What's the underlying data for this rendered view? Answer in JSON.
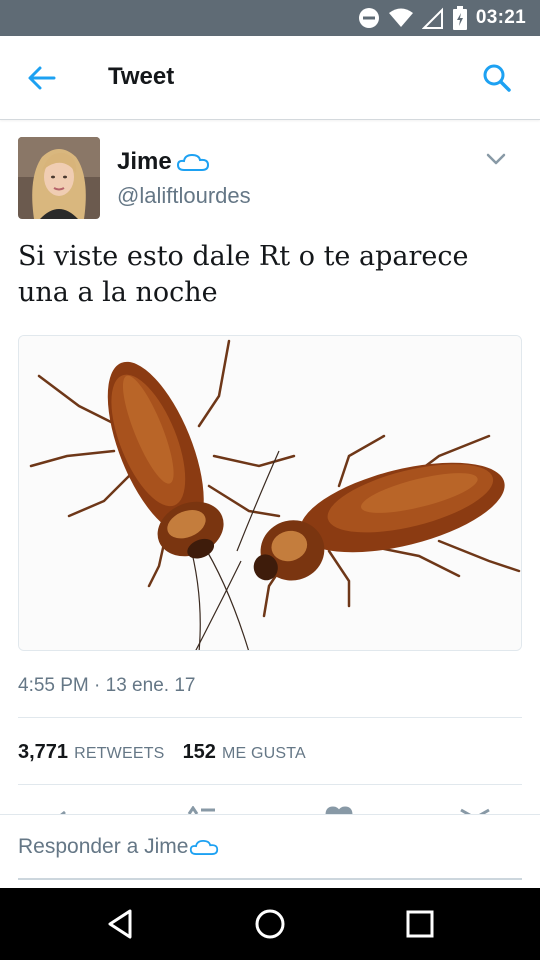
{
  "status_bar": {
    "time": "03:21"
  },
  "header": {
    "title": "Tweet"
  },
  "tweet": {
    "author_name": "Jime",
    "author_handle": "@laliftlourdes",
    "text": "Si viste esto dale Rt o te aparece una a la noche",
    "timestamp": "4:55 PM · 13 ene. 17",
    "retweets_count": "3,771",
    "retweets_label": "RETWEETS",
    "likes_count": "152",
    "likes_label": "ME GUSTA"
  },
  "reply": {
    "placeholder": "Responder a Jime"
  },
  "colors": {
    "accent": "#1da1f2",
    "status_bar": "#5f6b75",
    "nav_bar": "#000000",
    "text_secondary": "#657786"
  },
  "icons": {
    "back": "arrow-left-icon",
    "search": "search-icon",
    "caret": "chevron-down-icon",
    "cloud": "cloud-icon",
    "nav_back": "triangle-back-icon",
    "nav_home": "circle-home-icon",
    "nav_recents": "square-recents-icon"
  }
}
